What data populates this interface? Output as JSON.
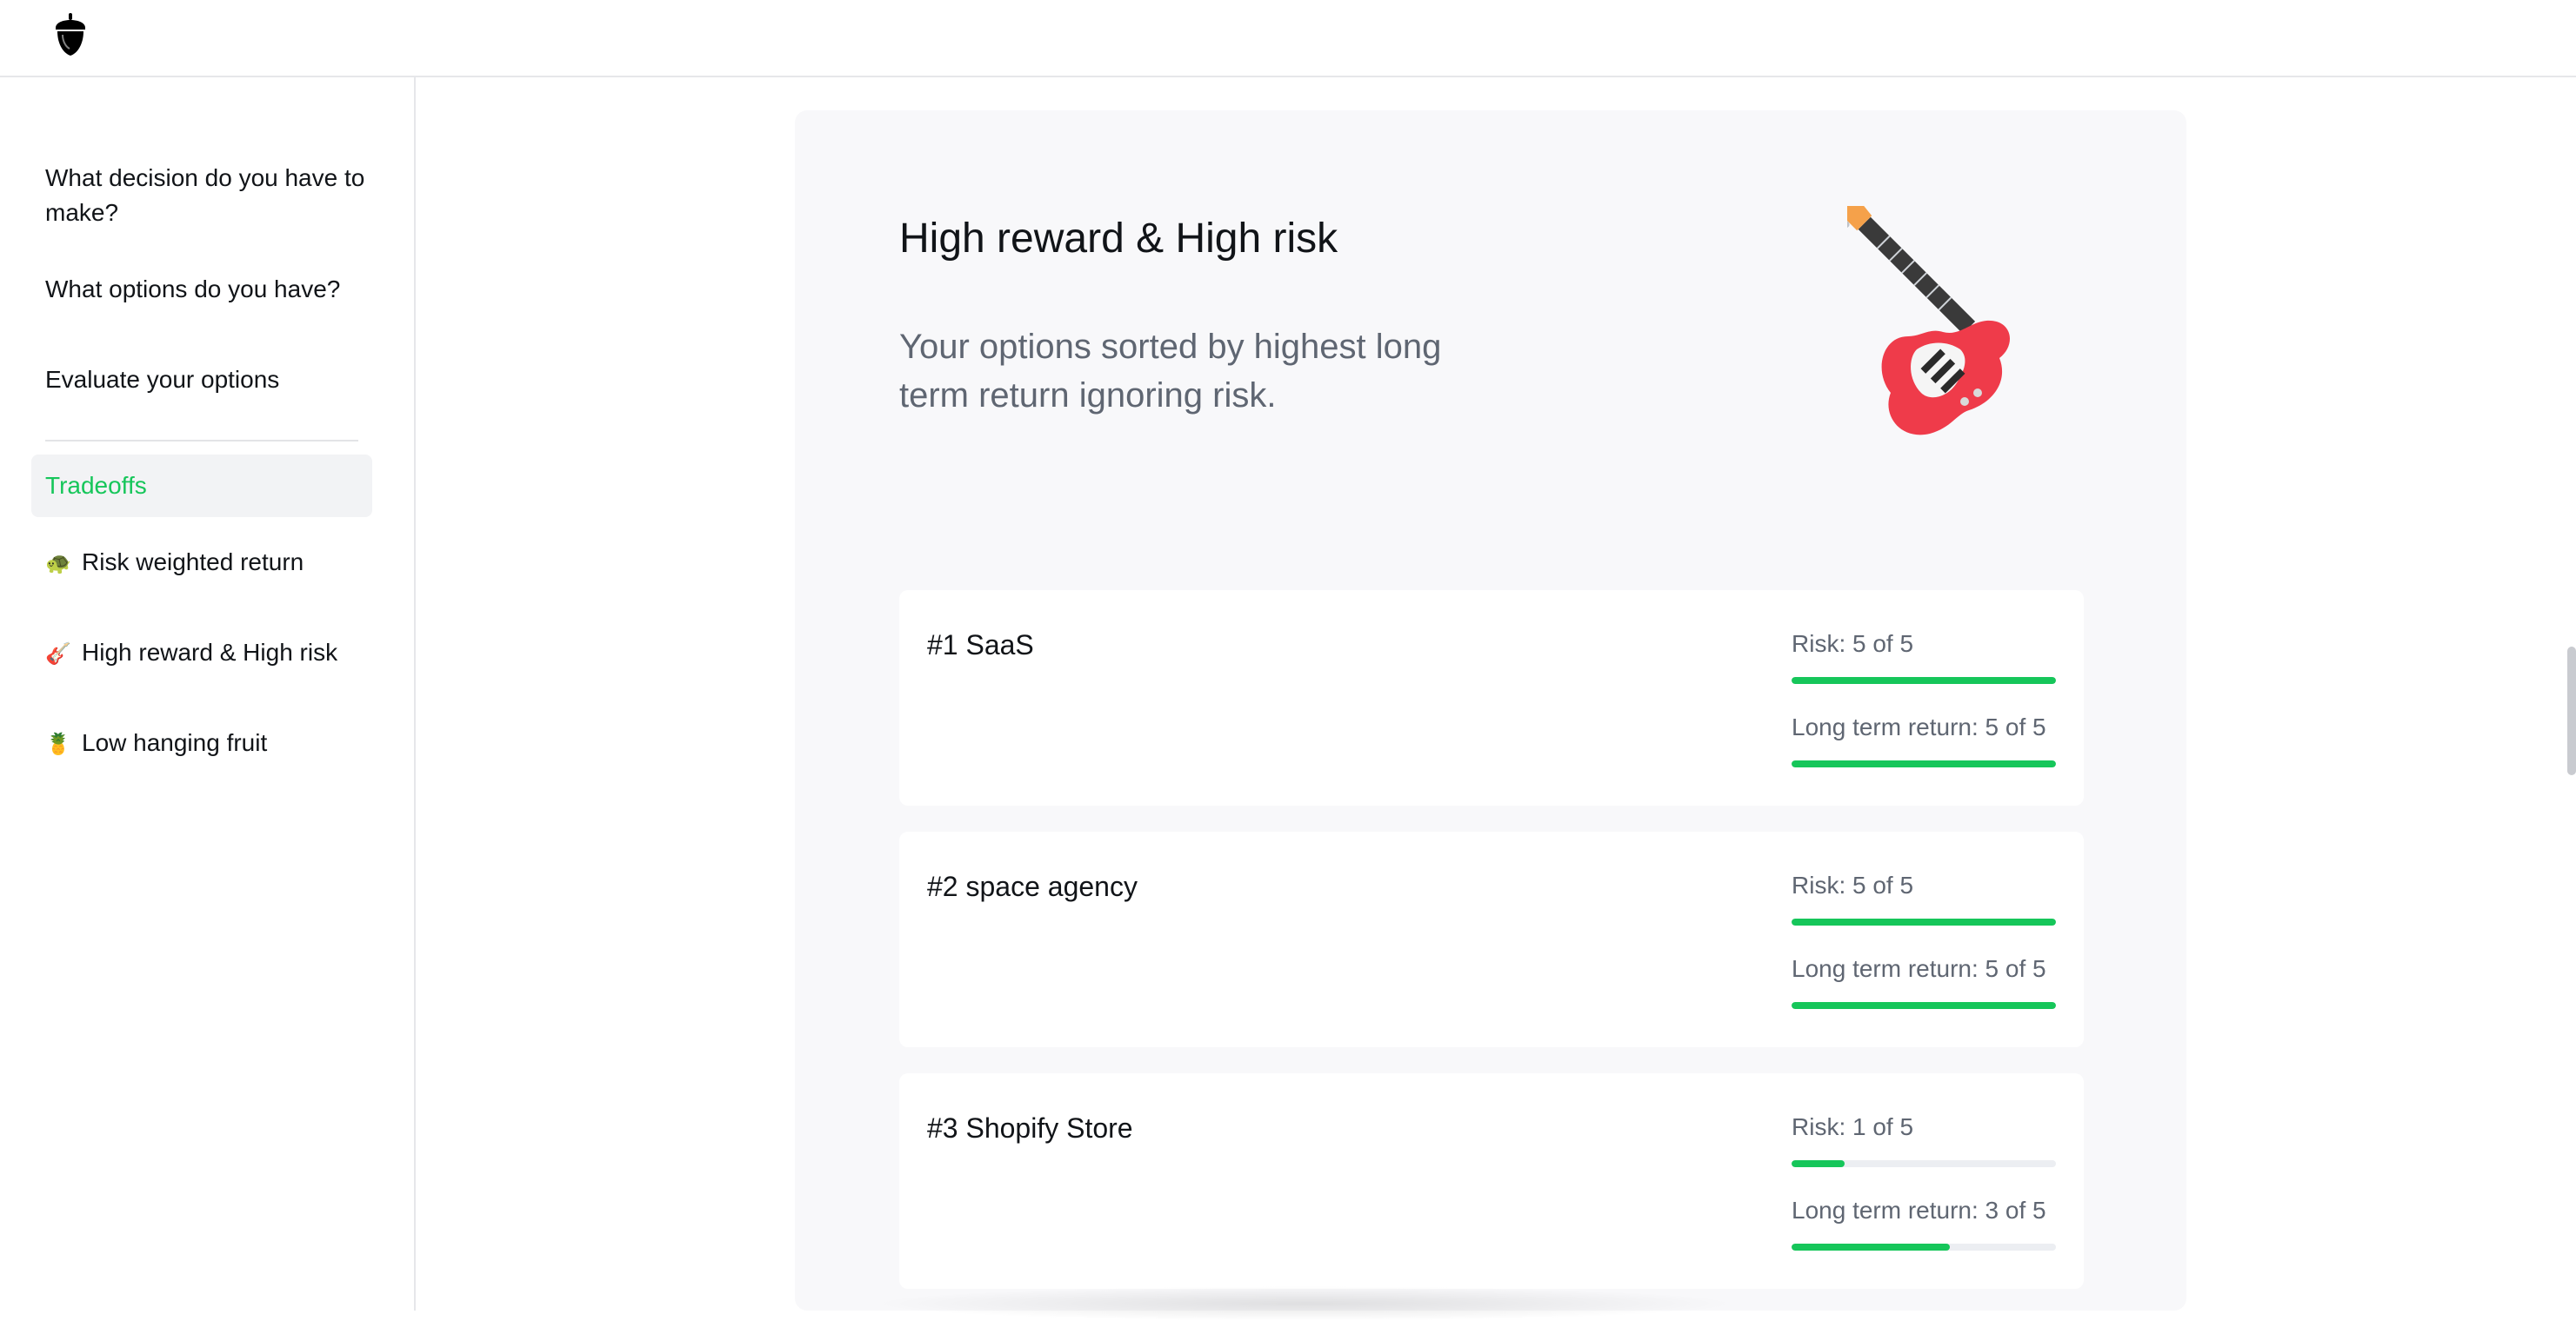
{
  "sidebar": {
    "items": [
      {
        "label": "What decision do you have to make?"
      },
      {
        "label": "What options do you have?"
      },
      {
        "label": "Evaluate your options"
      }
    ],
    "active_label": "Tradeoffs",
    "sub_items": [
      {
        "emoji": "🐢",
        "label": "Risk weighted return"
      },
      {
        "emoji": "🎸",
        "label": "High reward & High risk"
      },
      {
        "emoji": "🍍",
        "label": "Low hanging fruit"
      }
    ]
  },
  "main": {
    "title": "High reward & High risk",
    "subtitle": "Your options sorted by highest long term return ignoring risk.",
    "hero_icon": "guitar-icon",
    "options": [
      {
        "title": "#1 SaaS",
        "risk_label": "Risk: 5 of 5",
        "risk": 5,
        "return_label": "Long term return: 5 of 5",
        "return": 5
      },
      {
        "title": "#2 space agency",
        "risk_label": "Risk: 5 of 5",
        "risk": 5,
        "return_label": "Long term return: 5 of 5",
        "return": 5
      },
      {
        "title": "#3 Shopify Store",
        "risk_label": "Risk: 1 of 5",
        "risk": 1,
        "return_label": "Long term return: 3 of 5",
        "return": 3
      }
    ],
    "scale_max": 5
  },
  "colors": {
    "accent": "#16c65a",
    "panel_bg": "#f8f8fa",
    "muted_text": "#5f6672"
  }
}
